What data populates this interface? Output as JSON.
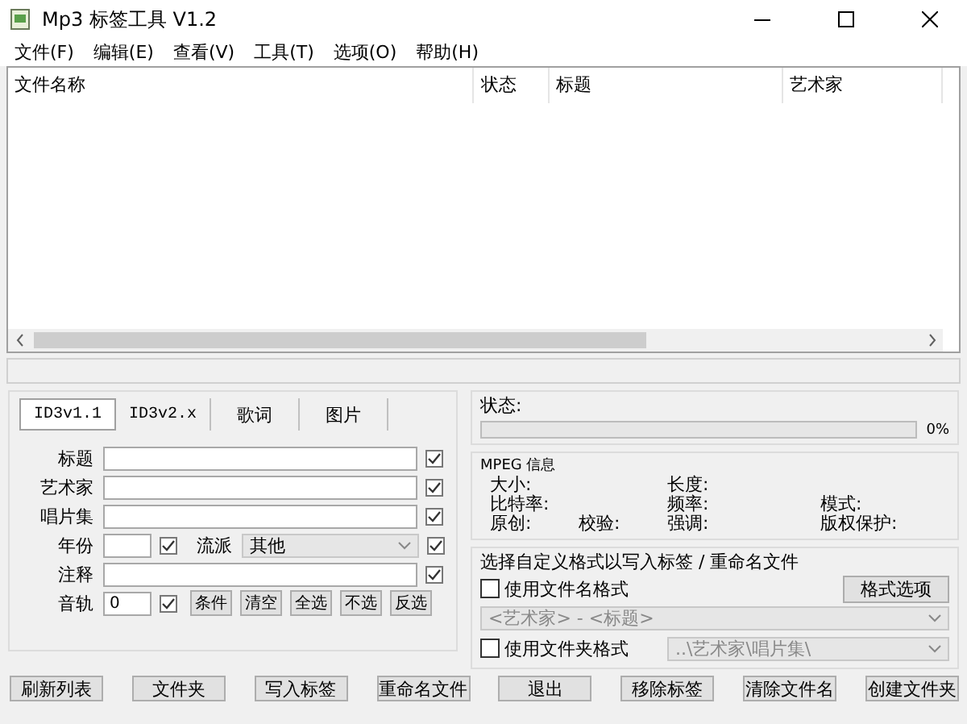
{
  "window": {
    "title": "Mp3 标签工具 V1.2"
  },
  "menu": [
    "文件(F)",
    "编辑(E)",
    "查看(V)",
    "工具(T)",
    "选项(O)",
    "帮助(H)"
  ],
  "file_list": {
    "columns": [
      "文件名称",
      "状态",
      "标题",
      "艺术家"
    ]
  },
  "tabs": [
    {
      "label": "ID3v1.1",
      "selected": true
    },
    {
      "label": "ID3v2.x",
      "selected": false
    },
    {
      "label": "歌词",
      "selected": false
    },
    {
      "label": "图片",
      "selected": false
    }
  ],
  "tag_fields": [
    {
      "kind": "text",
      "label": "标题",
      "checked": true
    },
    {
      "kind": "text",
      "label": "艺术家",
      "checked": true
    },
    {
      "kind": "text",
      "label": "唱片集",
      "checked": true
    },
    {
      "kind": "year_genre",
      "label": "年份",
      "checked": true,
      "genre_label": "流派",
      "genre_value": "其他",
      "genre_checked": true
    },
    {
      "kind": "text",
      "label": "注释",
      "checked": true
    },
    {
      "kind": "track",
      "label": "音轨",
      "value": "0",
      "checked": true,
      "buttons": [
        "条件",
        "清空",
        "全选",
        "不选",
        "反选"
      ]
    }
  ],
  "status": {
    "label": "状态:",
    "level": 0,
    "reading": "0%"
  },
  "mpeg_info": {
    "title": "MPEG 信息",
    "rows": [
      [
        "大小:",
        "",
        "长度:",
        ""
      ],
      [
        "比特率:",
        "",
        "频率:",
        "模式:"
      ],
      [
        "原创:",
        "校验:",
        "强调:",
        "版权保护:"
      ]
    ]
  },
  "format": {
    "title": "选择自定义格式以写入标签 / 重命名文件",
    "use_filename": {
      "label": "使用文件名格式",
      "checked": false
    },
    "options_button": "格式选项",
    "filename_format": "<艺术家> - <标题>",
    "use_folder": {
      "label": "使用文件夹格式",
      "checked": false
    },
    "folder_format": "..\\艺术家\\唱片集\\"
  },
  "buttons": [
    "刷新列表",
    "文件夹",
    "写入标签",
    "重命名文件",
    "退出",
    "移除标签",
    "清除文件名",
    "创建文件夹"
  ]
}
